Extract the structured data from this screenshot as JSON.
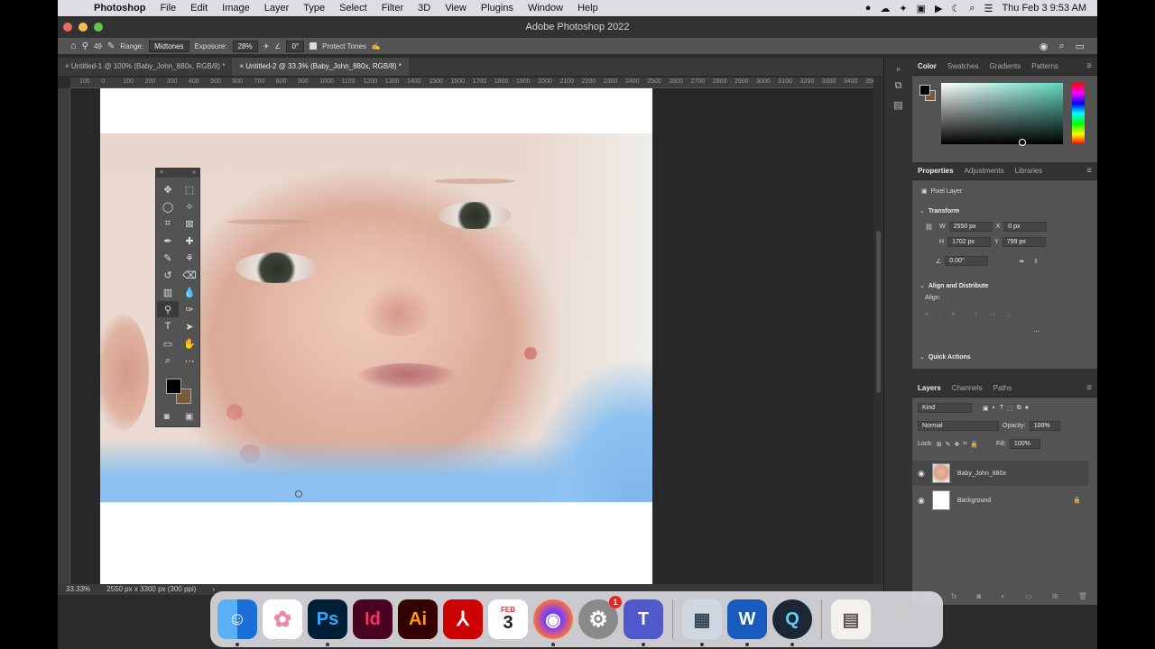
{
  "menubar": {
    "app_name": "Photoshop",
    "items": [
      "File",
      "Edit",
      "Image",
      "Layer",
      "Type",
      "Select",
      "Filter",
      "3D",
      "View",
      "Plugins",
      "Window",
      "Help"
    ],
    "datetime": "Thu Feb 3  9:53 AM"
  },
  "window": {
    "title": "Adobe Photoshop 2022"
  },
  "options": {
    "brush_size": "49",
    "range_label": "Range:",
    "range_value": "Midtones",
    "exposure_label": "Exposure:",
    "exposure_value": "28%",
    "angle_value": "0°",
    "protect_tones_label": "Protect Tones"
  },
  "doc_tabs": [
    {
      "label": "Untitled-1 @ 100% (Baby_John_880x, RGB/8) *"
    },
    {
      "label": "Untitled-2 @ 33.3% (Baby_John_880x, RGB/8) *"
    }
  ],
  "ruler": {
    "ticks": [
      "100",
      "0",
      "100",
      "200",
      "300",
      "400",
      "500",
      "600",
      "700",
      "800",
      "900",
      "1000",
      "1100",
      "1200",
      "1300",
      "1400",
      "1500",
      "1600",
      "1700",
      "1800",
      "1900",
      "2000",
      "2100",
      "2200",
      "2300",
      "2400",
      "2500",
      "2600",
      "2700",
      "2800",
      "2900",
      "3000",
      "3100",
      "3200",
      "3300",
      "3400",
      "3500"
    ]
  },
  "status": {
    "zoom": "33.33%",
    "doc_size": "2550 px x 3300 px (300 ppi)"
  },
  "color_panel": {
    "tabs": [
      "Color",
      "Swatches",
      "Gradients",
      "Patterns"
    ],
    "fg": "#000000",
    "bg": "#7a5a3a"
  },
  "properties": {
    "tabs": [
      "Properties",
      "Adjustments",
      "Libraries"
    ],
    "layer_type": "Pixel Layer",
    "transform_label": "Transform",
    "w_label": "W",
    "w": "2550 px",
    "x_label": "X",
    "x": "0 px",
    "h_label": "H",
    "h": "1702 px",
    "y_label": "Y",
    "y": "799 px",
    "angle": "0.00°",
    "align_label": "Align and Distribute",
    "align_sub": "Align:",
    "quick_actions": "Quick Actions"
  },
  "layers_panel": {
    "tabs": [
      "Layers",
      "Channels",
      "Paths"
    ],
    "kind": "Kind",
    "blend": "Normal",
    "opacity_label": "Opacity:",
    "opacity": "100%",
    "lock_label": "Lock:",
    "fill_label": "Fill:",
    "fill": "100%",
    "layers": [
      {
        "name": "Baby_John_880x"
      },
      {
        "name": "Background"
      }
    ]
  },
  "dock": {
    "apps": [
      {
        "name": "Finder"
      },
      {
        "name": "Photos"
      },
      {
        "name": "Ps"
      },
      {
        "name": "Id"
      },
      {
        "name": "Ai"
      },
      {
        "name": "Acrobat"
      },
      {
        "name": "Calendar",
        "month": "FEB",
        "day": "3"
      },
      {
        "name": "Firefox"
      },
      {
        "name": "System Preferences",
        "badge": "1"
      },
      {
        "name": "Teams"
      },
      {
        "name": "Preview"
      },
      {
        "name": "Word"
      },
      {
        "name": "QuickTime"
      },
      {
        "name": "Document"
      },
      {
        "name": "Trash"
      }
    ]
  },
  "colors": {
    "accent": "#2680eb"
  }
}
